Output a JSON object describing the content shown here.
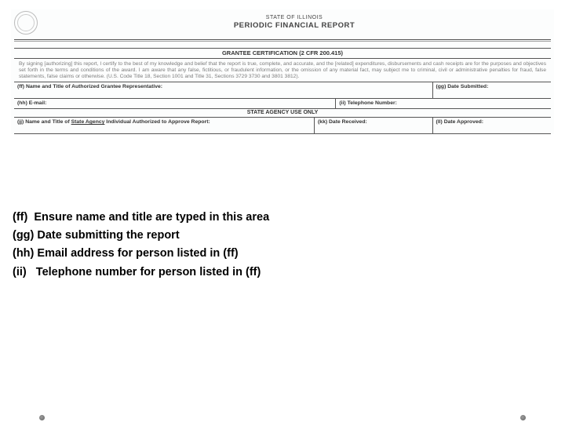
{
  "header": {
    "state": "STATE OF ILLINOIS",
    "title": "PERIODIC FINANCIAL REPORT"
  },
  "certification": {
    "bar": "GRANTEE CERTIFICATION (2 CFR 200.415)",
    "text": "By signing [authorizing] this report, I certify to the best of my knowledge and belief that the report is true, complete, and accurate, and the [related] expenditures, disbursements and cash receipts are for the purposes and objectives set forth in the terms and conditions of the award. I am aware that any false, fictitious, or fraudulent information, or the omission of any material fact, may subject me to criminal, civil or administrative penalties for fraud, false statements, false claims or otherwise. (U.S. Code Title 18, Section 1001 and Title 31, Sections 3729 3730 and 3801 3812)."
  },
  "fields": {
    "ff": "(ff) Name and Title of Authorized Grantee Representative:",
    "gg": "(gg) Date Submitted:",
    "hh": "(hh) E-mail:",
    "ii": "(ii) Telephone Number:",
    "agency_bar": "STATE AGENCY USE ONLY",
    "jj_pre": "(jj) Name and Title of ",
    "jj_und": "State Agency",
    "jj_post": " Individual Authorized to Approve Report:",
    "kk": "(kk) Date Received:",
    "ll": "(ll) Date Approved:"
  },
  "instructions": {
    "ff": "(ff)  Ensure name and title are typed in this area",
    "gg": "(gg) Date submitting the report",
    "hh": "(hh) Email address for person listed in (ff)",
    "ii": "(ii)   Telephone number for person listed in (ff)"
  }
}
